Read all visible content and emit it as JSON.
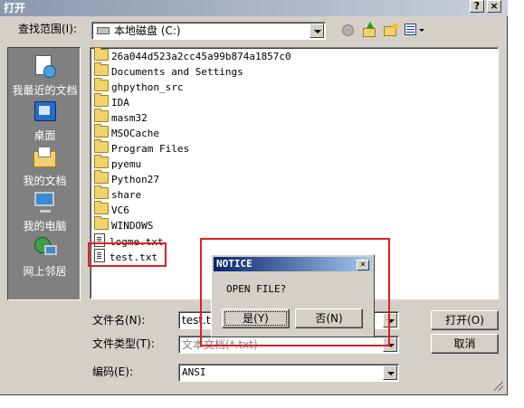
{
  "window": {
    "title": "打开",
    "help_btn": "?",
    "close_btn": "×"
  },
  "lookin": {
    "label": "查找范围(I):",
    "value": "本地磁盘 (C:)"
  },
  "places": [
    {
      "label": "我最近的文档",
      "icon": "recent-docs-icon"
    },
    {
      "label": "桌面",
      "icon": "desktop-icon"
    },
    {
      "label": "我的文档",
      "icon": "my-documents-icon"
    },
    {
      "label": "我的电脑",
      "icon": "my-computer-icon"
    },
    {
      "label": "网上邻居",
      "icon": "network-icon"
    }
  ],
  "files": [
    {
      "name": "26a044d523a2cc45a99b874a1857c0",
      "type": "folder"
    },
    {
      "name": "Documents and Settings",
      "type": "folder"
    },
    {
      "name": "ghpython_src",
      "type": "folder"
    },
    {
      "name": "IDA",
      "type": "folder"
    },
    {
      "name": "masm32",
      "type": "folder"
    },
    {
      "name": "MSOCache",
      "type": "folder"
    },
    {
      "name": "Program Files",
      "type": "folder"
    },
    {
      "name": "pyemu",
      "type": "folder"
    },
    {
      "name": "Python27",
      "type": "folder"
    },
    {
      "name": "share",
      "type": "folder"
    },
    {
      "name": "VC6",
      "type": "folder"
    },
    {
      "name": "WINDOWS",
      "type": "folder"
    },
    {
      "name": "logme.txt",
      "type": "file"
    },
    {
      "name": "test.txt",
      "type": "file"
    }
  ],
  "filename": {
    "label": "文件名(N):",
    "value": "test.t"
  },
  "filetype": {
    "label": "文件类型(T):",
    "value": "文本文档(*.txt)"
  },
  "encoding": {
    "label": "编码(E):",
    "value": "ANSI"
  },
  "buttons": {
    "open": "打开(O)",
    "cancel": "取消"
  },
  "notice": {
    "title": "NOTICE",
    "message": "OPEN FILE?",
    "yes": "是(Y)",
    "no": "否(N)",
    "close": "×"
  },
  "colors": {
    "highlight": "#e02020",
    "title_active": "#0a246a",
    "title_inactive": "#8b98ad"
  }
}
